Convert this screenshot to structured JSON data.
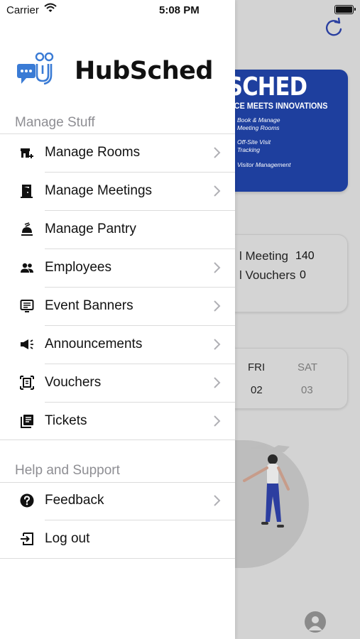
{
  "status_bar": {
    "carrier": "Carrier",
    "time": "5:08 PM"
  },
  "drawer": {
    "brand": "HubSched",
    "sections": [
      {
        "title": "Manage Stuff",
        "items": [
          {
            "label": "Manage Rooms",
            "icon": "room-add-icon",
            "chevron": true
          },
          {
            "label": "Manage Meetings",
            "icon": "door-icon",
            "chevron": true
          },
          {
            "label": "Manage Pantry",
            "icon": "food-tray-icon",
            "chevron": false
          },
          {
            "label": "Employees",
            "icon": "people-icon",
            "chevron": true
          },
          {
            "label": "Event Banners",
            "icon": "display-banner-icon",
            "chevron": true
          },
          {
            "label": "Announcements",
            "icon": "megaphone-icon",
            "chevron": true
          },
          {
            "label": "Vouchers",
            "icon": "voucher-icon",
            "chevron": true
          },
          {
            "label": "Tickets",
            "icon": "tickets-icon",
            "chevron": true
          }
        ]
      },
      {
        "title": "Help and Support",
        "items": [
          {
            "label": "Feedback",
            "icon": "help-circle-icon",
            "chevron": true
          },
          {
            "label": "Log out",
            "icon": "logout-icon",
            "chevron": false
          }
        ]
      }
    ]
  },
  "background": {
    "banner": {
      "title": "SCHED",
      "subtitle": "ACE MEETS INNOVATIONS",
      "features": [
        "Book & Manage Meeting Rooms",
        "Off-Site Visit Tracking",
        "Visitor Management"
      ]
    },
    "stats": [
      {
        "label": "l Meeting",
        "value": "140"
      },
      {
        "label": "l Vouchers",
        "value": "0"
      }
    ],
    "calendar": {
      "days": [
        {
          "day": "FRI",
          "date": "02"
        },
        {
          "day": "SAT",
          "date": "03"
        }
      ]
    },
    "colors": {
      "banner": "#1e3f9e",
      "accent": "#2a3fa0"
    }
  }
}
